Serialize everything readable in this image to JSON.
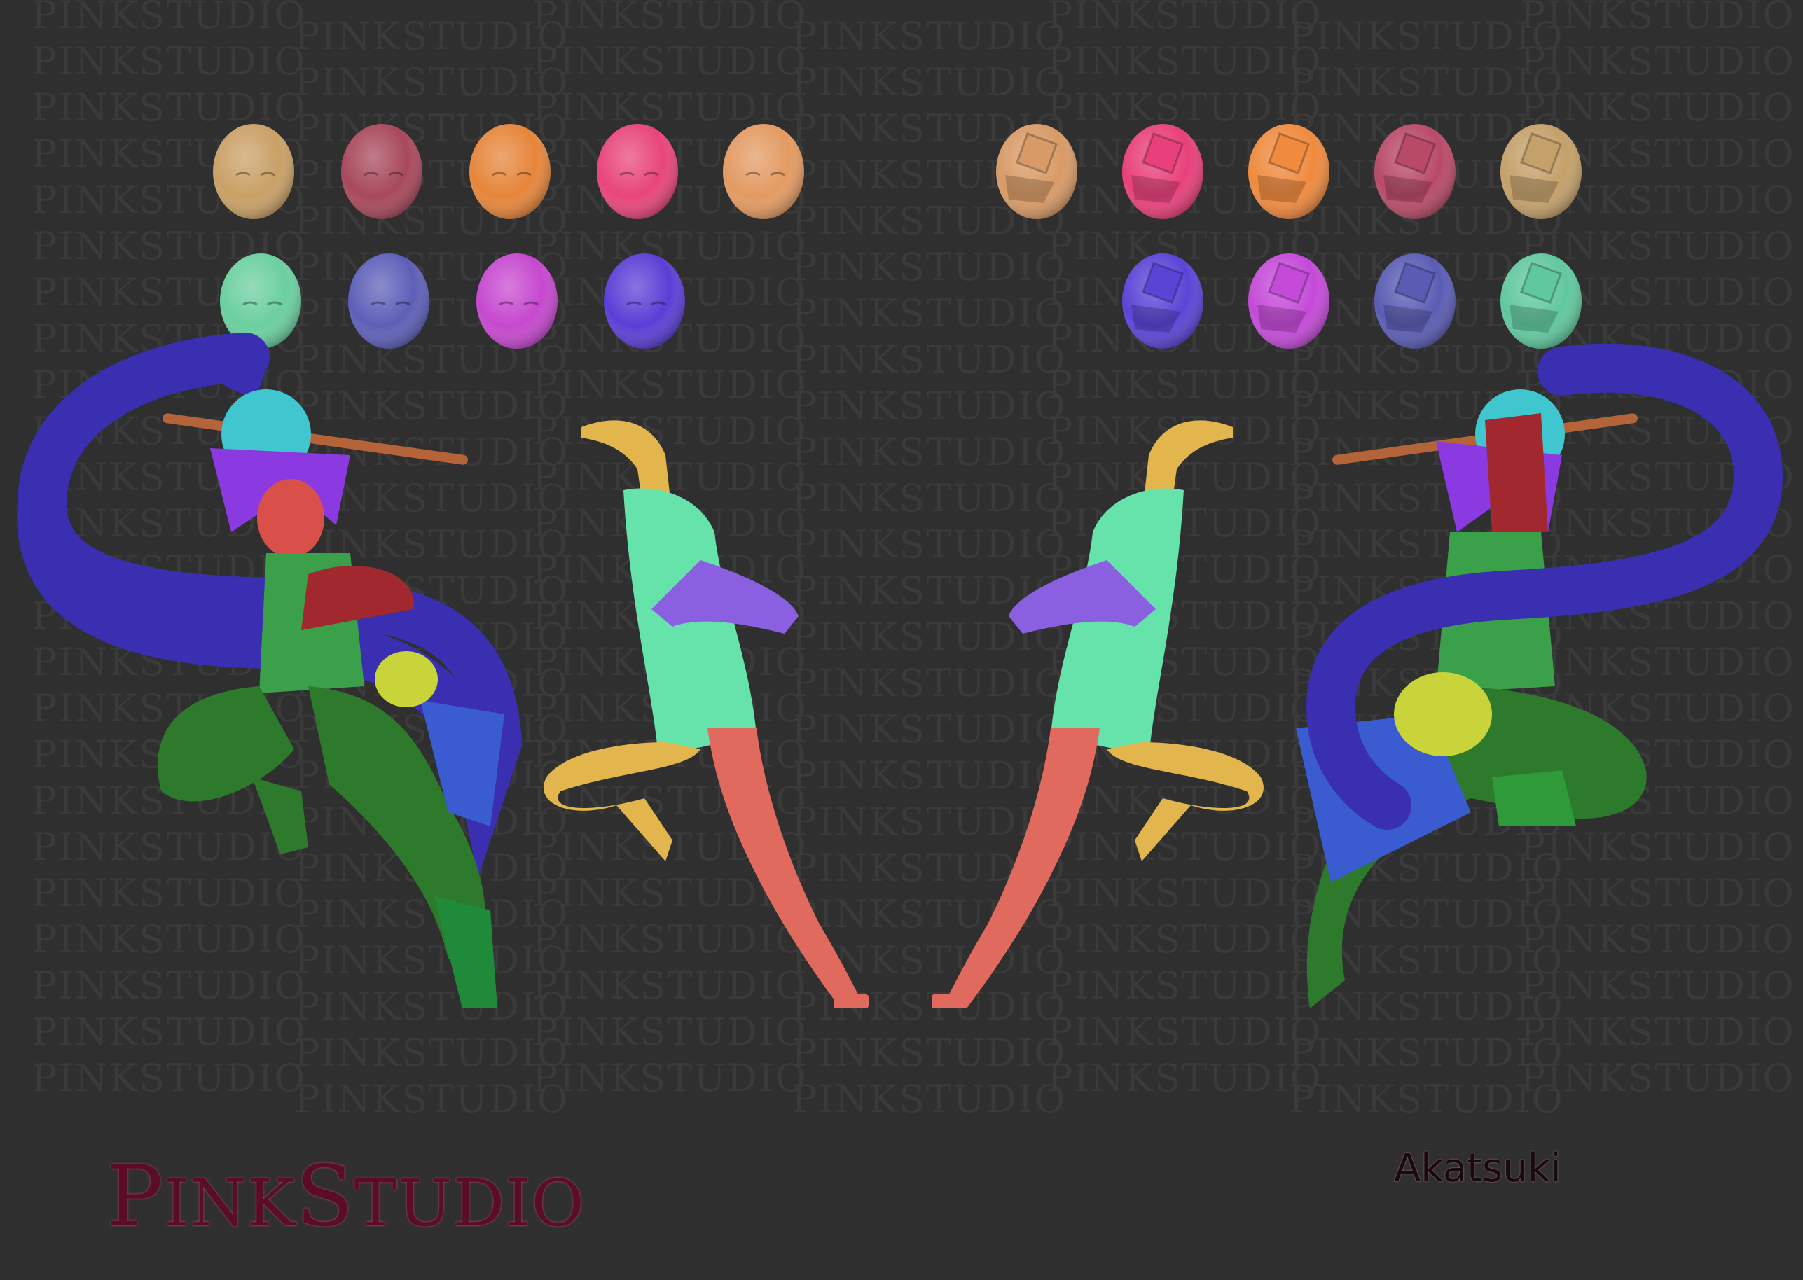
{
  "watermark": {
    "text": "PINKSTUDIO"
  },
  "logo": {
    "text": "PinkStudio",
    "first": "P",
    "mid": "INK",
    "second": "S",
    "last": "TUDIO"
  },
  "caption": {
    "title": "Akatsuki"
  },
  "colors": {
    "background": "#2f2f30",
    "heads": [
      "#c9a066",
      "#a8485c",
      "#e6853a",
      "#e8457a",
      "#e39a62",
      "#6bcfa0",
      "#5d5fb8",
      "#c648cf",
      "#5a3ed6"
    ],
    "heads_back": [
      "#d89a66",
      "#e8407a",
      "#ef8a3e",
      "#b84a68",
      "#c4a06a",
      "#5a44d6",
      "#c44ad8",
      "#5a5cb4",
      "#60c89e"
    ],
    "body_mint": "#66e3ab",
    "arm_purple": "#8a5fe0",
    "leg_yellow": "#e3b64d",
    "leg_red": "#e06a5e",
    "hair_blue": "#3a2fb0",
    "pants_green": "#2e7a2c",
    "bag_yellow": "#c9d43a",
    "scarf_blue": "#3a5cd0"
  }
}
